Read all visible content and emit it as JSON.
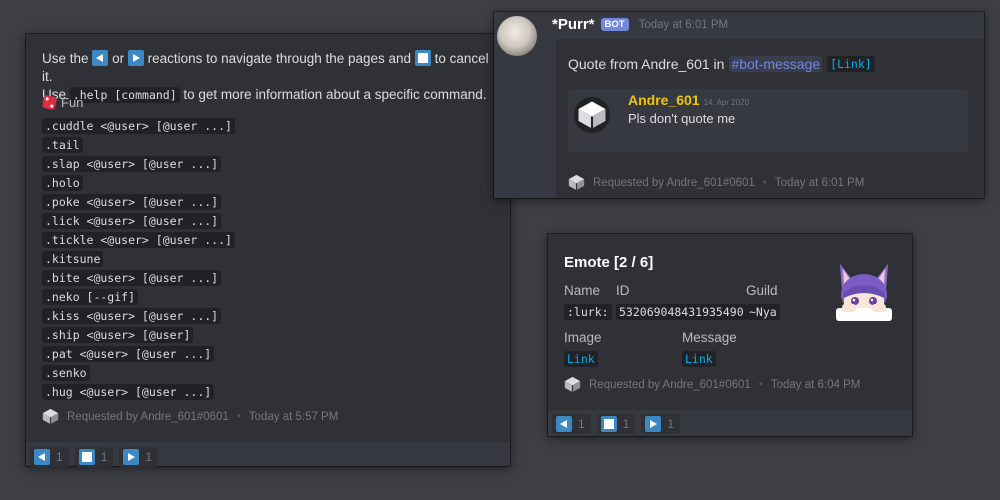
{
  "help_panel": {
    "desc_use": "Use the",
    "desc_or": "or",
    "desc_nav": "reactions to navigate through the pages and",
    "desc_cancel": "to cancel it.",
    "desc_use2": "Use",
    "help_cmd": ".help [command]",
    "desc_more": "to get more information about a specific command.",
    "field_title": "Fun",
    "commands": [
      ".cuddle <@user> [@user ...]",
      ".tail",
      ".slap <@user> [@user ...]",
      ".holo",
      ".poke <@user> [@user ...]",
      ".lick <@user> [@user ...]",
      ".tickle <@user> [@user ...]",
      ".kitsune",
      ".bite <@user> [@user ...]",
      ".neko [--gif]",
      ".kiss <@user> [@user ...]",
      ".ship <@user> [@user]",
      ".pat <@user> [@user ...]",
      ".senko",
      ".hug <@user> [@user ...]"
    ],
    "footer_text": "Requested by Andre_601#0601",
    "footer_sep": "•",
    "footer_time": "Today at 5:57 PM",
    "reactions": [
      "1",
      "1",
      "1"
    ]
  },
  "quote_panel": {
    "username": "*Purr*",
    "bot_tag": "BOT",
    "timestamp": "Today at 6:01 PM",
    "quote_from": "Quote from Andre_601 in",
    "channel": "#bot-message",
    "link": "[Link]",
    "author": "Andre_601",
    "author_date": "14. Apr 2020",
    "message": "Pls don't quote me",
    "footer_text": "Requested by Andre_601#0601",
    "footer_sep": "•",
    "footer_time": "Today at 6:01 PM"
  },
  "emote_panel": {
    "title": "Emote [2 / 6]",
    "name_label": "Name",
    "name_value": ":lurk:",
    "id_label": "ID",
    "id_value": "532069048431935490",
    "guild_label": "Guild",
    "guild_value": "~Nya",
    "image_label": "Image",
    "image_value": "Link",
    "message_label": "Message",
    "message_value": "Link",
    "footer_text": "Requested by Andre_601#0601",
    "footer_sep": "•",
    "footer_time": "Today at 6:04 PM",
    "reactions": [
      "1",
      "1",
      "1"
    ]
  },
  "colors": {
    "background": "#3d3f45",
    "embed": "#2f3136",
    "blurple": "#7289da",
    "author_gold": "#f1c40f",
    "link": "#00aff4",
    "reaction_blue": "#3b88c3"
  },
  "icons": [
    "arrow-left-reaction-icon",
    "stop-reaction-icon",
    "arrow-right-reaction-icon",
    "game-die-icon",
    "cube-icon"
  ]
}
